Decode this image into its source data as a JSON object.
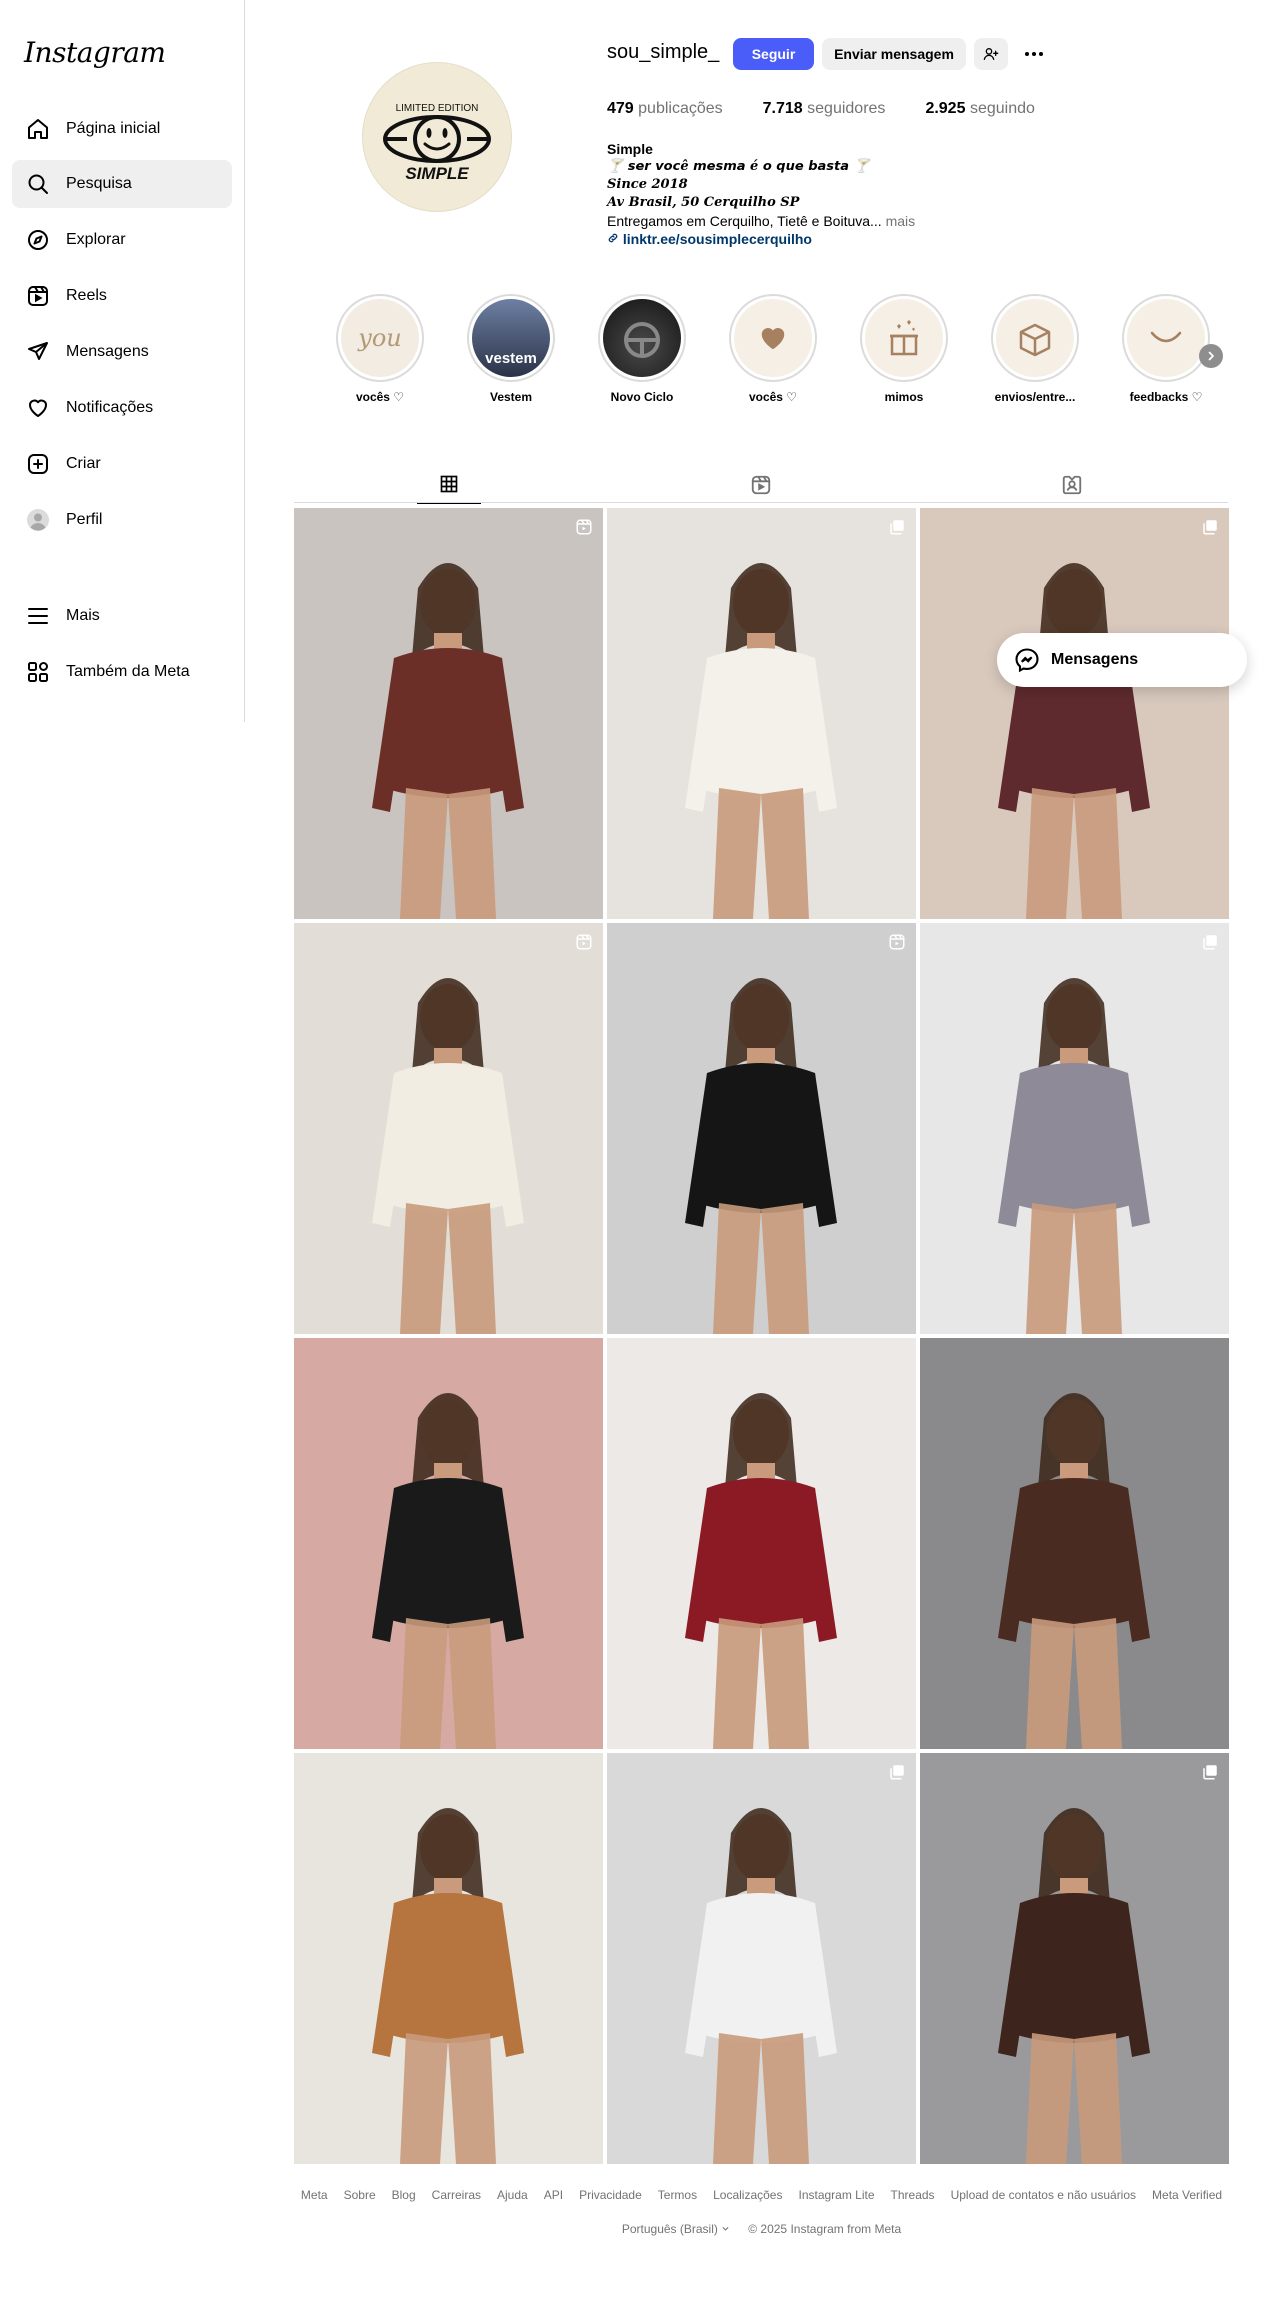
{
  "brand": {
    "logo_text": "Instagram"
  },
  "sidebar": {
    "items": [
      {
        "label": "Página inicial",
        "icon": "home-icon"
      },
      {
        "label": "Pesquisa",
        "icon": "search-icon"
      },
      {
        "label": "Explorar",
        "icon": "compass-icon"
      },
      {
        "label": "Reels",
        "icon": "reels-icon"
      },
      {
        "label": "Mensagens",
        "icon": "send-icon"
      },
      {
        "label": "Notificações",
        "icon": "heart-icon"
      },
      {
        "label": "Criar",
        "icon": "plus-square-icon"
      },
      {
        "label": "Perfil",
        "icon": "avatar-icon"
      },
      {
        "label": "Mais",
        "icon": "menu-icon"
      },
      {
        "label": "Também da Meta",
        "icon": "meta-apps-icon"
      }
    ]
  },
  "profile": {
    "username": "sou_simple_",
    "follow_label": "Seguir",
    "message_label": "Enviar mensagem",
    "avatar": {
      "top_text": "LIMITED EDITION",
      "bottom_text": "SIMPLE"
    },
    "stats": {
      "posts_count": "479",
      "posts_label": "publicações",
      "followers_count": "7.718",
      "followers_label": "seguidores",
      "following_count": "2.925",
      "following_label": "seguindo"
    },
    "bio": {
      "name": "Simple",
      "line1": "🍸 𝙨𝙚𝙧 𝙫𝙤𝙘ê 𝙢𝙚𝙨𝙢𝙖 é 𝙤 𝙦𝙪𝙚 𝙗𝙖𝙨𝙩𝙖 🍸",
      "line2": "Since 2018",
      "line3": "Av Brasil, 50 Cerquilho SP",
      "line4": "Entregamos em Cerquilho, Tietê e Boituva...",
      "more": "mais",
      "link": "linktr.ee/sousimplecerquilho"
    }
  },
  "highlights": [
    {
      "label": "vocês ♡",
      "cover_text": "you"
    },
    {
      "label": "Vestem",
      "cover_text": "vestem"
    },
    {
      "label": "Novo Ciclo",
      "cover_text": ""
    },
    {
      "label": "vocês ♡",
      "cover_text": ""
    },
    {
      "label": "mimos",
      "cover_text": ""
    },
    {
      "label": "envios/entre...",
      "cover_text": ""
    },
    {
      "label": "feedbacks ♡",
      "cover_text": ""
    }
  ],
  "tabs": [
    {
      "name": "posts",
      "icon": "grid-icon",
      "active": true
    },
    {
      "name": "reels",
      "icon": "reels-icon",
      "active": false
    },
    {
      "name": "tagged",
      "icon": "tagged-icon",
      "active": false
    }
  ],
  "posts": [
    {
      "bg": "#c9c4c0",
      "dress": "#6b2f27",
      "type": "reel"
    },
    {
      "bg": "#e6e3df",
      "dress": "#f4f1ea",
      "type": "multi"
    },
    {
      "bg": "#d9c9bd",
      "dress": "#5e2a2e",
      "type": "multi"
    },
    {
      "bg": "#e2ddd7",
      "dress": "#f2ede2",
      "type": "reel"
    },
    {
      "bg": "#cfcfcf",
      "dress": "#151515",
      "type": "reel"
    },
    {
      "bg": "#e7e7e7",
      "dress": "#8e8a97",
      "type": "multi"
    },
    {
      "bg": "#d6a9a3",
      "dress": "#1a1a1a",
      "type": "none"
    },
    {
      "bg": "#ece9e6",
      "dress": "#8b1a25",
      "type": "none"
    },
    {
      "bg": "#8a8a8c",
      "dress": "#4a2b22",
      "type": "none"
    },
    {
      "bg": "#e8e4de",
      "dress": "#b6743f",
      "type": "none"
    },
    {
      "bg": "#d9d9d9",
      "dress": "#f1f1f1",
      "type": "multi"
    },
    {
      "bg": "#9a9a9c",
      "dress": "#3d241c",
      "type": "multi"
    }
  ],
  "messages_pill": {
    "label": "Mensagens"
  },
  "footer": {
    "links": [
      "Meta",
      "Sobre",
      "Blog",
      "Carreiras",
      "Ajuda",
      "API",
      "Privacidade",
      "Termos",
      "Localizações",
      "Instagram Lite",
      "Threads",
      "Upload de contatos e não usuários",
      "Meta Verified"
    ],
    "language": "Português (Brasil)",
    "copyright": "© 2025 Instagram from Meta"
  }
}
